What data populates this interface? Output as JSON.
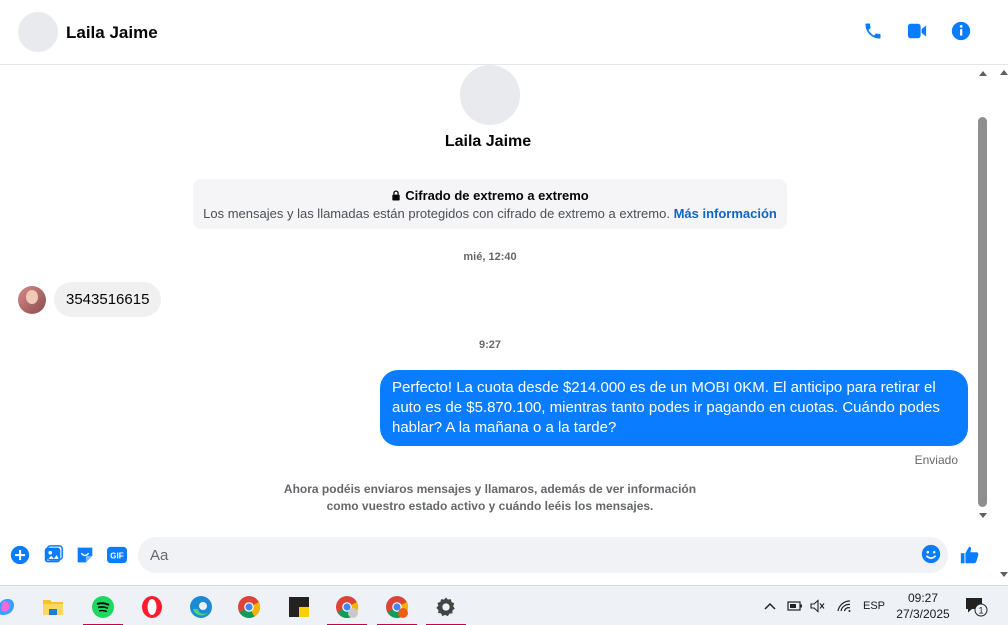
{
  "header": {
    "contact_name": "Laila Jaime",
    "actions": [
      "phone-icon",
      "video-icon",
      "info-icon"
    ]
  },
  "profile": {
    "name": "Laila Jaime"
  },
  "encryption": {
    "title": "Cifrado de extremo a extremo",
    "description": "Los mensajes y las llamadas están protegidos con cifrado de extremo a extremo.",
    "link": "Más información"
  },
  "messages": [
    {
      "timestamp": "mié, 12:40",
      "direction": "incoming",
      "text": "3543516615"
    },
    {
      "timestamp": "9:27",
      "direction": "outgoing",
      "text": "Perfecto! La cuota desde $214.000 es de un MOBI 0KM. El anticipo para retirar el auto es de $5.870.100, mientras tanto podes ir pagando en cuotas. Cuándo podes hablar? A la mañana o a la tarde?",
      "status": "Enviado"
    }
  ],
  "notice": "Ahora podéis enviaros mensajes y llamaros, además de ver información como vuestro estado activo y cuándo leéis los mensajes.",
  "composer": {
    "placeholder": "Aa",
    "buttons": [
      "plus-icon",
      "image-icon",
      "sticker-icon",
      "gif-icon"
    ],
    "gif_label": "GIF"
  },
  "taskbar": {
    "apps": [
      "copilot",
      "file-explorer",
      "spotify",
      "opera",
      "edge",
      "chrome",
      "sticky-notes",
      "chrome-profile-1",
      "chrome-profile-2",
      "settings"
    ],
    "language": "ESP",
    "time": "09:27",
    "date": "27/3/2025",
    "notification_count": "1"
  },
  "colors": {
    "accent": "#0a7cff",
    "link": "#1264c2",
    "incoming_bubble": "#f0f0f0"
  }
}
